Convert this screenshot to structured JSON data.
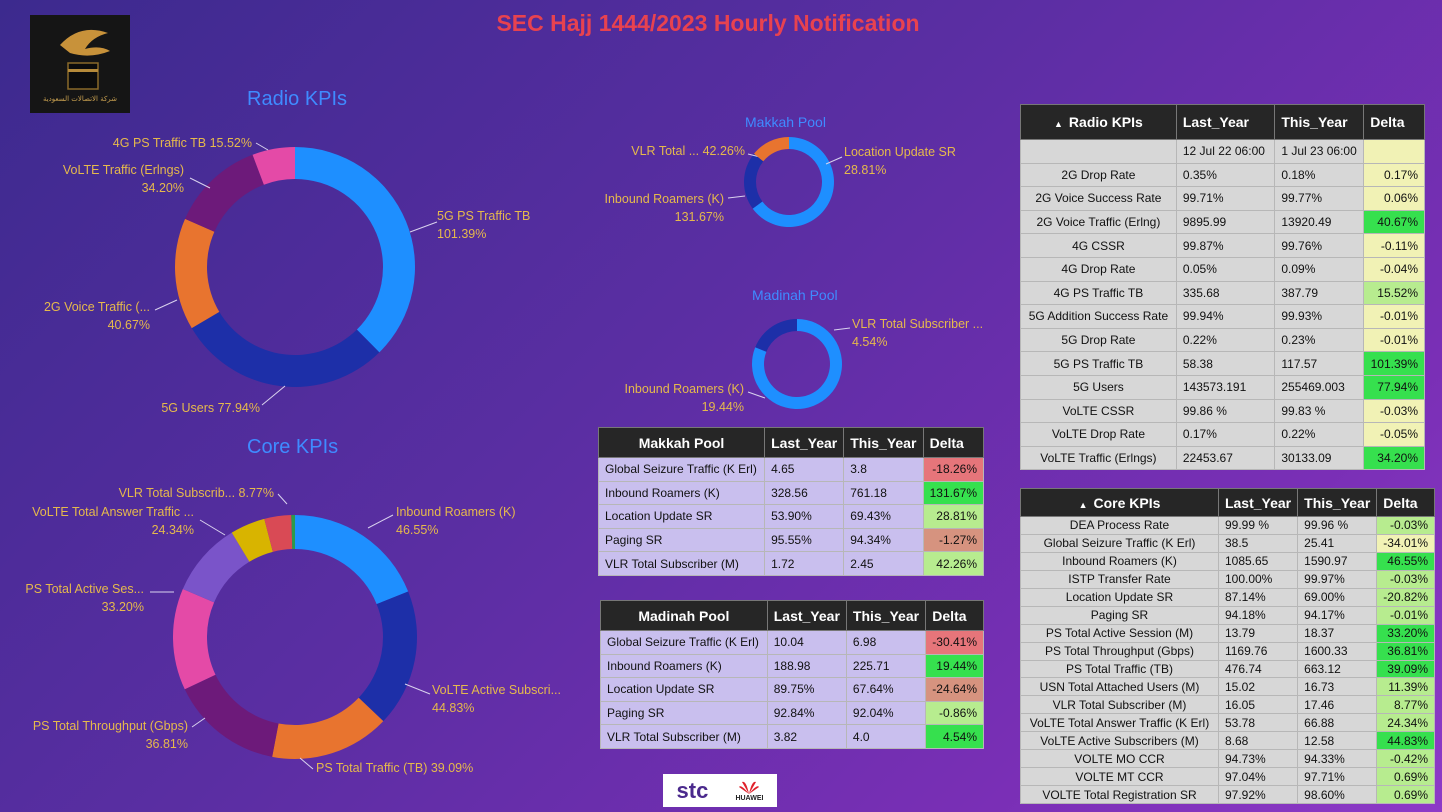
{
  "page": {
    "title": "SEC Hajj 1444/2023 Hourly Notification",
    "logo_text": "شركة الاتصالات السعودية",
    "footer_stc": "stc",
    "footer_huawei": "HUAWEI"
  },
  "sections": {
    "radio_title": "Radio KPIs",
    "core_title": "Core KPIs",
    "makkah_title": "Makkah Pool",
    "madinah_title": "Madinah Pool"
  },
  "colors": {
    "blue": "#1e8fff",
    "navy": "#1d2fa8",
    "orange": "#e8742f",
    "purple": "#6d1a7a",
    "pink": "#e44aa7",
    "violet": "#7a54c9",
    "gold": "#d8b400",
    "red": "#d94a55",
    "green": "#2d9a4a",
    "delta_green": "#36e04e",
    "delta_lightgreen": "#b7ec8f",
    "delta_yellow": "#f1f2b5",
    "delta_red": "#e6757a",
    "delta_salmon": "#d6937f"
  },
  "chart_data": [
    {
      "id": "radio",
      "type": "pie",
      "series": [
        {
          "name": "5G PS Traffic TB",
          "value": 101.39,
          "label": "5G PS Traffic TB\n101.39%",
          "color": "#1e8fff"
        },
        {
          "name": "5G Users",
          "value": 77.94,
          "label": "5G Users 77.94%",
          "color": "#1d2fa8"
        },
        {
          "name": "2G Voice Traffic (...",
          "value": 40.67,
          "label": "2G Voice Traffic (...\n40.67%",
          "color": "#e8742f"
        },
        {
          "name": "VoLTE Traffic (Erlngs)",
          "value": 34.2,
          "label": "VoLTE Traffic (Erlngs)\n34.20%",
          "color": "#6d1a7a"
        },
        {
          "name": "4G PS Traffic TB",
          "value": 15.52,
          "label": "4G PS Traffic TB 15.52%",
          "color": "#e44aa7"
        }
      ]
    },
    {
      "id": "core",
      "type": "pie",
      "series": [
        {
          "name": "Inbound Roamers (K)",
          "value": 46.55,
          "label": "Inbound Roamers (K)\n46.55%",
          "color": "#1e8fff"
        },
        {
          "name": "VoLTE Active Subscri...",
          "value": 44.83,
          "label": "VoLTE Active Subscri...\n44.83%",
          "color": "#1d2fa8"
        },
        {
          "name": "PS Total Traffic (TB)",
          "value": 39.09,
          "label": "PS Total Traffic (TB) 39.09%",
          "color": "#e8742f"
        },
        {
          "name": "PS Total Throughput (Gbps)",
          "value": 36.81,
          "label": "PS Total Throughput (Gbps)\n36.81%",
          "color": "#6d1a7a"
        },
        {
          "name": "PS Total Active Ses...",
          "value": 33.2,
          "label": "PS Total Active Ses...\n33.20%",
          "color": "#e44aa7"
        },
        {
          "name": "VoLTE Total Answer Traffic ...",
          "value": 24.34,
          "label": "VoLTE Total Answer Traffic ...\n24.34%",
          "color": "#7a54c9"
        },
        {
          "name": "VLR Total Subscrib...",
          "value": 11.39,
          "label": "",
          "color": "#d8b400"
        },
        {
          "name": "VLR Total Subscrib...",
          "value": 8.77,
          "label": "VLR Total Subscrib... 8.77%",
          "color": "#d94a55"
        },
        {
          "name": "USN",
          "value": 1.2,
          "label": "",
          "color": "#2d9a4a"
        }
      ]
    },
    {
      "id": "makkah",
      "type": "pie",
      "series": [
        {
          "name": "Inbound Roamers (K)",
          "value": 131.67,
          "label": "Inbound Roamers (K)\n131.67%",
          "color": "#1e8fff"
        },
        {
          "name": "VLR Total ...",
          "value": 42.26,
          "label": "VLR Total ... 42.26%",
          "color": "#1d2fa8"
        },
        {
          "name": "Location Update SR",
          "value": 28.81,
          "label": "Location Update SR\n28.81%",
          "color": "#e8742f"
        }
      ]
    },
    {
      "id": "madinah",
      "type": "pie",
      "series": [
        {
          "name": "Inbound Roamers (K)",
          "value": 19.44,
          "label": "Inbound Roamers (K)\n19.44%",
          "color": "#1e8fff"
        },
        {
          "name": "VLR Total Subscriber ...",
          "value": 4.54,
          "label": "VLR Total Subscriber ...\n4.54%",
          "color": "#1d2fa8"
        }
      ]
    }
  ],
  "radio_table": {
    "headers": [
      "Radio KPIs",
      "Last_Year",
      "This_Year",
      "Delta"
    ],
    "rows": [
      {
        "name": "",
        "last": "12 Jul 22 06:00",
        "this": "1 Jul 23 06:00",
        "delta": "",
        "tone": "yellow"
      },
      {
        "name": "2G Drop Rate",
        "last": "0.35%",
        "this": "0.18%",
        "delta": "0.17%",
        "tone": "yellow"
      },
      {
        "name": "2G Voice Success Rate",
        "last": "99.71%",
        "this": "99.77%",
        "delta": "0.06%",
        "tone": "yellow"
      },
      {
        "name": "2G Voice Traffic (Erlng)",
        "last": "9895.99",
        "this": "13920.49",
        "delta": "40.67%",
        "tone": "green"
      },
      {
        "name": "4G CSSR",
        "last": "99.87%",
        "this": "99.76%",
        "delta": "-0.11%",
        "tone": "yellow"
      },
      {
        "name": "4G Drop Rate",
        "last": "0.05%",
        "this": "0.09%",
        "delta": "-0.04%",
        "tone": "yellow"
      },
      {
        "name": "4G PS Traffic TB",
        "last": "335.68",
        "this": "387.79",
        "delta": "15.52%",
        "tone": "lightgreen"
      },
      {
        "name": "5G Addition Success Rate",
        "last": "99.94%",
        "this": "99.93%",
        "delta": "-0.01%",
        "tone": "yellow"
      },
      {
        "name": "5G Drop Rate",
        "last": "0.22%",
        "this": "0.23%",
        "delta": "-0.01%",
        "tone": "yellow"
      },
      {
        "name": "5G PS Traffic TB",
        "last": "58.38",
        "this": "117.57",
        "delta": "101.39%",
        "tone": "green"
      },
      {
        "name": "5G Users",
        "last": "143573.191",
        "this": "255469.003",
        "delta": "77.94%",
        "tone": "green"
      },
      {
        "name": "VoLTE CSSR",
        "last": "99.86 %",
        "this": "99.83 %",
        "delta": "-0.03%",
        "tone": "yellow"
      },
      {
        "name": "VoLTE Drop Rate",
        "last": "0.17%",
        "this": "0.22%",
        "delta": "-0.05%",
        "tone": "yellow"
      },
      {
        "name": "VoLTE Traffic (Erlngs)",
        "last": "22453.67",
        "this": "30133.09",
        "delta": "34.20%",
        "tone": "green"
      }
    ]
  },
  "core_table": {
    "headers": [
      "Core KPIs",
      "Last_Year",
      "This_Year",
      "Delta"
    ],
    "rows": [
      {
        "name": "DEA Process Rate",
        "last": "99.99 %",
        "this": "99.96 %",
        "delta": "-0.03%",
        "tone": "lightgreen"
      },
      {
        "name": "Global Seizure Traffic (K Erl)",
        "last": "38.5",
        "this": "25.41",
        "delta": "-34.01%",
        "tone": "yellow"
      },
      {
        "name": "Inbound Roamers (K)",
        "last": "1085.65",
        "this": "1590.97",
        "delta": "46.55%",
        "tone": "green"
      },
      {
        "name": "ISTP Transfer Rate",
        "last": "100.00%",
        "this": "99.97%",
        "delta": "-0.03%",
        "tone": "lightgreen"
      },
      {
        "name": "Location Update SR",
        "last": "87.14%",
        "this": "69.00%",
        "delta": "-20.82%",
        "tone": "lightgreen"
      },
      {
        "name": "Paging SR",
        "last": "94.18%",
        "this": "94.17%",
        "delta": "-0.01%",
        "tone": "lightgreen"
      },
      {
        "name": "PS Total Active Session (M)",
        "last": "13.79",
        "this": "18.37",
        "delta": "33.20%",
        "tone": "green"
      },
      {
        "name": "PS Total Throughput (Gbps)",
        "last": "1169.76",
        "this": "1600.33",
        "delta": "36.81%",
        "tone": "green"
      },
      {
        "name": "PS Total Traffic (TB)",
        "last": "476.74",
        "this": "663.12",
        "delta": "39.09%",
        "tone": "green"
      },
      {
        "name": "USN Total Attached Users (M)",
        "last": "15.02",
        "this": "16.73",
        "delta": "11.39%",
        "tone": "lightgreen"
      },
      {
        "name": "VLR Total Subscriber (M)",
        "last": "16.05",
        "this": "17.46",
        "delta": "8.77%",
        "tone": "lightgreen"
      },
      {
        "name": "VoLTE Total Answer Traffic (K Erl)",
        "last": "53.78",
        "this": "66.88",
        "delta": "24.34%",
        "tone": "lightgreen"
      },
      {
        "name": "VoLTE Active Subscribers (M)",
        "last": "8.68",
        "this": "12.58",
        "delta": "44.83%",
        "tone": "green"
      },
      {
        "name": "VOLTE MO CCR",
        "last": "94.73%",
        "this": "94.33%",
        "delta": "-0.42%",
        "tone": "lightgreen"
      },
      {
        "name": "VOLTE MT CCR",
        "last": "97.04%",
        "this": "97.71%",
        "delta": "0.69%",
        "tone": "lightgreen"
      },
      {
        "name": "VOLTE Total Registration SR",
        "last": "97.92%",
        "this": "98.60%",
        "delta": "0.69%",
        "tone": "lightgreen"
      }
    ]
  },
  "makkah_table": {
    "headers": [
      "Makkah Pool",
      "Last_Year",
      "This_Year",
      "Delta"
    ],
    "rows": [
      {
        "name": "Global Seizure Traffic (K Erl)",
        "last": "4.65",
        "this": "3.8",
        "delta": "-18.26%",
        "tone": "red"
      },
      {
        "name": "Inbound Roamers (K)",
        "last": "328.56",
        "this": "761.18",
        "delta": "131.67%",
        "tone": "green"
      },
      {
        "name": "Location Update SR",
        "last": "53.90%",
        "this": "69.43%",
        "delta": "28.81%",
        "tone": "lightgreen"
      },
      {
        "name": "Paging SR",
        "last": "95.55%",
        "this": "94.34%",
        "delta": "-1.27%",
        "tone": "salmon"
      },
      {
        "name": "VLR Total Subscriber (M)",
        "last": "1.72",
        "this": "2.45",
        "delta": "42.26%",
        "tone": "lightgreen"
      }
    ]
  },
  "madinah_table": {
    "headers": [
      "Madinah Pool",
      "Last_Year",
      "This_Year",
      "Delta"
    ],
    "rows": [
      {
        "name": "Global Seizure Traffic (K Erl)",
        "last": "10.04",
        "this": "6.98",
        "delta": "-30.41%",
        "tone": "red"
      },
      {
        "name": "Inbound Roamers (K)",
        "last": "188.98",
        "this": "225.71",
        "delta": "19.44%",
        "tone": "green"
      },
      {
        "name": "Location Update SR",
        "last": "89.75%",
        "this": "67.64%",
        "delta": "-24.64%",
        "tone": "salmon"
      },
      {
        "name": "Paging SR",
        "last": "92.84%",
        "this": "92.04%",
        "delta": "-0.86%",
        "tone": "lightgreen"
      },
      {
        "name": "VLR Total Subscriber (M)",
        "last": "3.82",
        "this": "4.0",
        "delta": "4.54%",
        "tone": "green"
      }
    ]
  }
}
